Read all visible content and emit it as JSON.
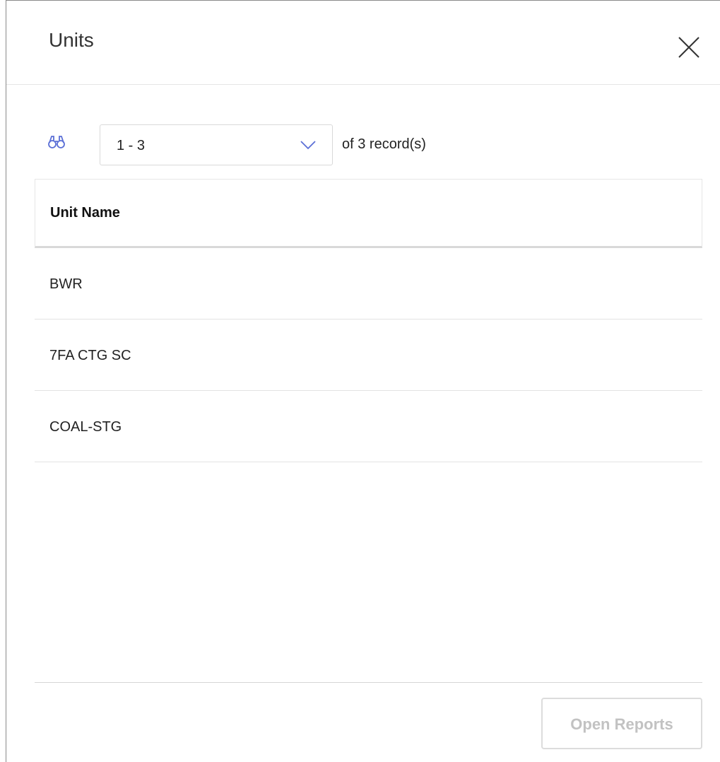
{
  "dialog": {
    "title": "Units",
    "close_icon": "close-icon"
  },
  "toolbar": {
    "search_icon": "binoculars-icon",
    "range_select": {
      "value": "1 - 3"
    },
    "records_text": "of 3 record(s)"
  },
  "table": {
    "columns": [
      "Unit Name"
    ],
    "rows": [
      {
        "unit_name": "BWR"
      },
      {
        "unit_name": "7FA CTG SC"
      },
      {
        "unit_name": "COAL-STG"
      }
    ]
  },
  "footer": {
    "open_reports_label": "Open Reports",
    "open_reports_enabled": false
  },
  "colors": {
    "accent": "#5b6fd6",
    "disabled_text": "#c2c2c2",
    "divider": "#e6e6e6"
  }
}
